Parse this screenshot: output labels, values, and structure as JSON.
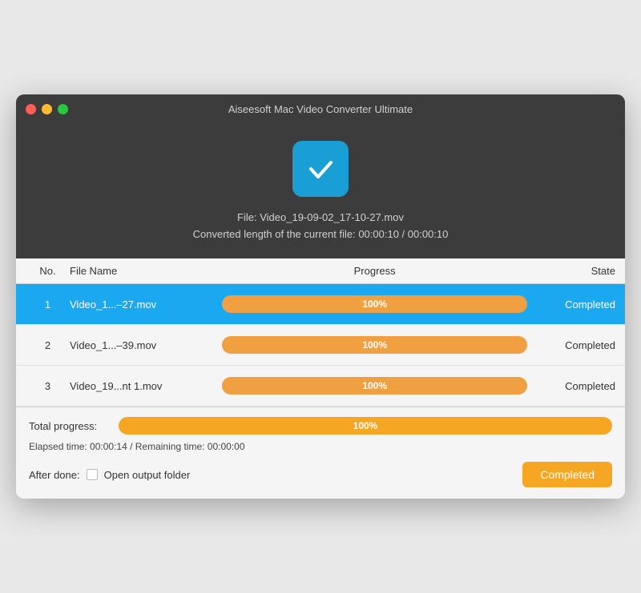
{
  "window": {
    "title": "Aiseesoft Mac Video Converter Ultimate"
  },
  "header": {
    "file_label": "File: Video_19-09-02_17-10-27.mov",
    "converted_length": "Converted length of the current file: 00:00:10 / 00:00:10"
  },
  "table": {
    "columns": {
      "no": "No.",
      "file_name": "File Name",
      "progress": "Progress",
      "state": "State"
    },
    "rows": [
      {
        "no": "1",
        "file_name": "Video_1...–27.mov",
        "progress": "100%",
        "state": "Completed",
        "selected": true
      },
      {
        "no": "2",
        "file_name": "Video_1...–39.mov",
        "progress": "100%",
        "state": "Completed",
        "selected": false
      },
      {
        "no": "3",
        "file_name": "Video_19...nt 1.mov",
        "progress": "100%",
        "state": "Completed",
        "selected": false
      }
    ]
  },
  "footer": {
    "total_progress_label": "Total progress:",
    "total_progress_value": "100%",
    "elapsed_time": "Elapsed time: 00:00:14 / Remaining time: 00:00:00",
    "after_done_label": "After done:",
    "open_output_folder": "Open output folder",
    "completed_button": "Completed"
  },
  "traffic_lights": {
    "close": "close",
    "minimize": "minimize",
    "maximize": "maximize"
  }
}
